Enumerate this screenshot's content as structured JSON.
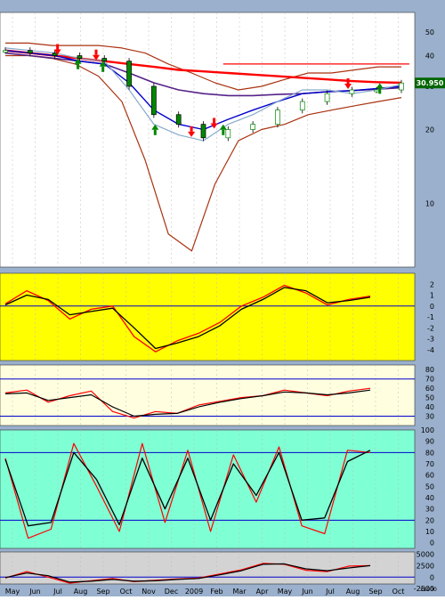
{
  "chart_data": {
    "type": "line",
    "months": [
      "May",
      "Jun",
      "Jul",
      "Aug",
      "Sep",
      "Oct",
      "Nov",
      "Dec",
      "2009",
      "Feb",
      "Mar",
      "Apr",
      "May",
      "Jun",
      "Jul",
      "Aug",
      "Sep",
      "Oct"
    ],
    "last_price_label": "30.950",
    "colors": {
      "frame_bg": "#9ab0cc",
      "price_bg": "#ffffff",
      "macd_bg": "#ffff00",
      "rsi_bg": "#ffffe0",
      "stoch_bg": "#7fffd4",
      "osc_bg": "#d3d3d3",
      "red": "#ff0000",
      "black": "#000000",
      "blue": "#0000cc",
      "purple": "#552288",
      "brown": "#aa3311",
      "light_blue": "#88aacc",
      "green": "#008800",
      "price_tag_bg": "#006600"
    },
    "panels": [
      {
        "id": "price",
        "scale": "log",
        "ylim": [
          5.5,
          60
        ],
        "ticks": [
          "50",
          "40",
          "30",
          "20",
          "10"
        ],
        "tick_values": [
          50,
          40,
          30,
          20,
          10
        ],
        "bands_upper": [
          45,
          45,
          44,
          44,
          44,
          43,
          41,
          37,
          34,
          31,
          29,
          30,
          32,
          34,
          34,
          35,
          36,
          36
        ],
        "bands_lower": [
          40,
          40,
          39,
          37,
          33,
          26,
          15,
          7.5,
          6.4,
          12,
          18,
          20,
          21,
          23,
          24,
          25,
          26,
          27
        ],
        "red_ma": [
          42,
          41,
          40,
          39,
          38,
          37,
          36,
          35,
          34.5,
          34,
          33.5,
          33,
          32.5,
          32,
          31.5,
          31.2,
          31
        ],
        "purple_ma": [
          41,
          40,
          39,
          38,
          37,
          34,
          31,
          29,
          28,
          27.5,
          27.5,
          27.8,
          28,
          28.5,
          28.8,
          29.2,
          29.6
        ],
        "blue_ma": [
          42,
          41,
          40,
          38,
          37,
          31,
          24,
          21,
          20,
          22,
          24,
          26,
          28,
          28.5,
          28.8,
          29.4,
          30
        ],
        "light_blue_ma": [
          43,
          42,
          41,
          39,
          38,
          29,
          21,
          19,
          18,
          21,
          23,
          26,
          29,
          29,
          28,
          29,
          30.5
        ],
        "price_close": [
          42,
          41,
          40,
          39,
          38,
          30,
          23,
          21,
          18.5,
          20,
          21,
          24,
          26,
          28,
          29,
          29,
          30.95
        ],
        "resistance_line": {
          "from_month": 9.6,
          "to_month": 17.8,
          "value": 37
        },
        "arrows_up": [
          3.2,
          4.3,
          6.6,
          9.6,
          16.5
        ],
        "arrows_down": [
          2.3,
          4.0,
          8.2,
          9.2,
          15.1
        ]
      },
      {
        "id": "macd",
        "ylim": [
          -5,
          3
        ],
        "ticks": [
          "2",
          "1",
          "0",
          "-1",
          "-2",
          "-3",
          "-4"
        ],
        "tick_values": [
          2,
          1,
          0,
          -1,
          -2,
          -3,
          -4
        ],
        "ref_lines": [
          0
        ],
        "macd": [
          0.2,
          1.4,
          0.5,
          -1.2,
          -0.3,
          0.0,
          -2.8,
          -4.2,
          -3.2,
          -2.5,
          -1.5,
          0.0,
          0.8,
          1.9,
          1.2,
          0.1,
          0.6,
          0.9
        ],
        "signal": [
          0.1,
          1.0,
          0.6,
          -0.8,
          -0.5,
          -0.2,
          -2.0,
          -3.9,
          -3.4,
          -2.8,
          -1.8,
          -0.3,
          0.6,
          1.7,
          1.4,
          0.3,
          0.5,
          0.8
        ]
      },
      {
        "id": "rsi",
        "ylim": [
          20,
          85
        ],
        "ticks": [
          "80",
          "70",
          "60",
          "50",
          "40",
          "30"
        ],
        "tick_values": [
          80,
          70,
          60,
          50,
          40,
          30
        ],
        "ref_lines": [
          70,
          30
        ],
        "rsi": [
          55,
          58,
          45,
          52,
          57,
          35,
          28,
          35,
          33,
          42,
          46,
          50,
          52,
          58,
          55,
          52,
          57,
          60
        ],
        "rsi_smooth": [
          54,
          55,
          47,
          50,
          53,
          40,
          30,
          32,
          33,
          40,
          45,
          49,
          52,
          56,
          55,
          53,
          55,
          58
        ]
      },
      {
        "id": "stochastic",
        "ylim": [
          -5,
          100
        ],
        "ticks": [
          "100",
          "90",
          "80",
          "70",
          "60",
          "50",
          "40",
          "30",
          "20",
          "10",
          "0"
        ],
        "tick_values": [
          100,
          90,
          80,
          70,
          60,
          50,
          40,
          30,
          20,
          10,
          0
        ],
        "ref_lines": [
          80,
          20
        ],
        "k": [
          75,
          4,
          12,
          88,
          50,
          10,
          88,
          18,
          82,
          10,
          78,
          36,
          85,
          15,
          8,
          82,
          80
        ],
        "d": [
          74,
          15,
          18,
          80,
          56,
          16,
          75,
          30,
          75,
          20,
          70,
          42,
          80,
          20,
          22,
          72,
          82
        ]
      },
      {
        "id": "oscillator",
        "ylim": [
          -1500,
          5500
        ],
        "ticks": [
          "5000",
          "2500",
          "0",
          "-2500"
        ],
        "tick_values": [
          5000,
          2500,
          0,
          -2500
        ],
        "ref_lines": [
          0
        ],
        "osc": [
          -200,
          1200,
          0,
          -1300,
          -800,
          -300,
          -1000,
          -700,
          -400,
          -200,
          700,
          1600,
          3000,
          2800,
          1500,
          1200,
          2400,
          2500
        ],
        "osc_smooth": [
          -100,
          900,
          300,
          -1100,
          -900,
          -500,
          -900,
          -800,
          -500,
          -300,
          500,
          1400,
          2800,
          2900,
          1800,
          1400,
          2000,
          2500
        ]
      }
    ],
    "xaxis_label": "x1000"
  }
}
